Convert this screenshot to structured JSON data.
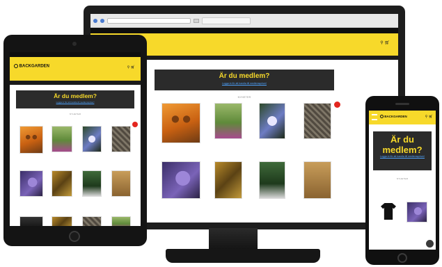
{
  "monitor": {
    "browser": {
      "tab_title": "",
      "url": ""
    },
    "topbar": {
      "left": "",
      "right": ""
    },
    "nav_items": [
      "",
      "",
      "",
      "",
      ""
    ],
    "banner": {
      "title": "Är du medlem?",
      "subtitle": "Logga in för att handla till medlemspriser!"
    },
    "section_label": "NYHETER",
    "products": [
      {
        "cover": "owl",
        "caption": ""
      },
      {
        "cover": "garden",
        "caption": ""
      },
      {
        "cover": "orchid",
        "caption": ""
      },
      {
        "cover": "stone",
        "caption": ""
      },
      {
        "cover": "iris",
        "caption": ""
      },
      {
        "cover": "leaf",
        "caption": ""
      },
      {
        "cover": "forest",
        "caption": ""
      },
      {
        "cover": "book",
        "caption": ""
      }
    ]
  },
  "tablet": {
    "topbar": {
      "left": "",
      "right": ""
    },
    "logo_text": "BACKGARDEN",
    "nav_items": [
      "",
      "",
      "",
      ""
    ],
    "banner": {
      "title": "Är du medlem?",
      "subtitle": "Logga in för att handla till medlemspriser!"
    },
    "section_label": "NYHETER",
    "products": [
      {
        "cover": "owl",
        "caption": ""
      },
      {
        "cover": "garden",
        "caption": ""
      },
      {
        "cover": "orchid",
        "caption": ""
      },
      {
        "cover": "stone",
        "caption": ""
      },
      {
        "cover": "iris",
        "caption": ""
      },
      {
        "cover": "leaf",
        "caption": ""
      },
      {
        "cover": "forest",
        "caption": ""
      },
      {
        "cover": "book",
        "caption": ""
      }
    ]
  },
  "phone": {
    "logo_text": "BACKGARDEN",
    "banner": {
      "title": "Är du medlem?",
      "subtitle": "Logga in för att handla till medlemspriser!"
    },
    "section_label": "NYHETER",
    "products": [
      {
        "cover": "tshirt",
        "caption": ""
      },
      {
        "cover": "iris",
        "caption": ""
      }
    ]
  },
  "colors": {
    "brand_yellow": "#f7d92a",
    "banner_dark": "#2b2b2b",
    "link_blue": "#4da3ff",
    "badge_red": "#e3261f",
    "price_green": "#3a9a3a"
  }
}
